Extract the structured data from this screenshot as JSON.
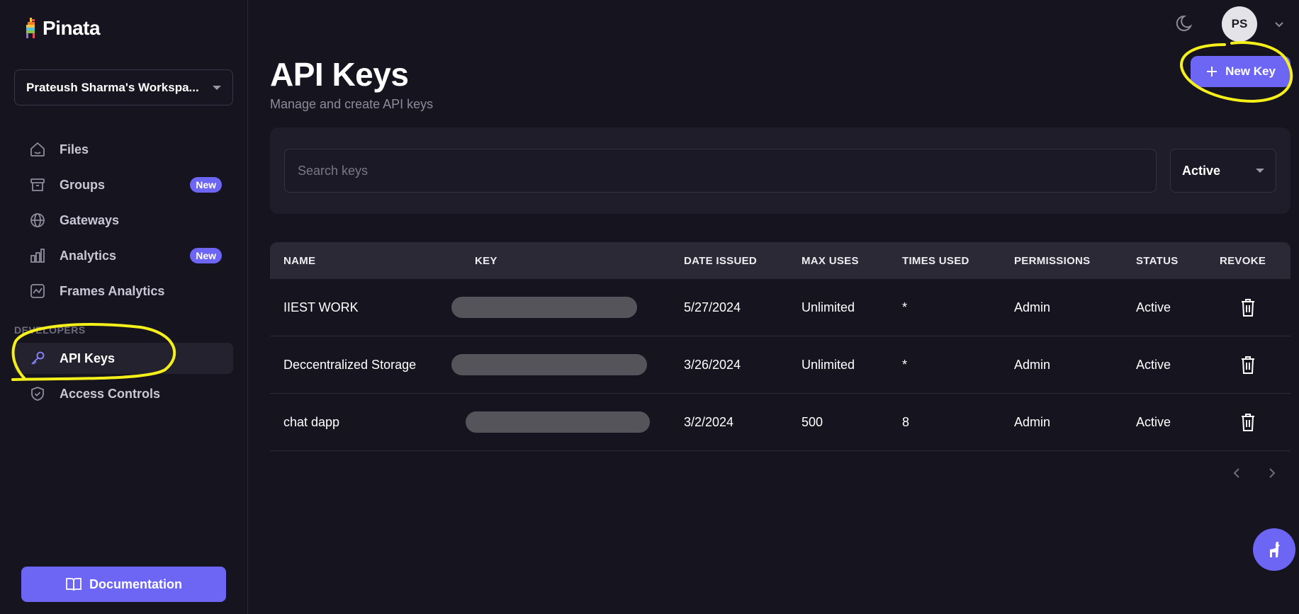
{
  "app": {
    "brand": "Pinata",
    "accent_color": "#6d66f5"
  },
  "sidebar": {
    "workspace": "Prateush Sharma's Workspa...",
    "items": [
      {
        "label": "Files",
        "icon": "home-icon"
      },
      {
        "label": "Groups",
        "icon": "archive-icon",
        "badge": "New"
      },
      {
        "label": "Gateways",
        "icon": "globe-icon"
      },
      {
        "label": "Analytics",
        "icon": "bar-chart-icon",
        "badge": "New"
      },
      {
        "label": "Frames Analytics",
        "icon": "line-chart-icon"
      }
    ],
    "section_label": "DEVELOPERS",
    "dev_items": [
      {
        "label": "API Keys",
        "icon": "key-icon",
        "active": true
      },
      {
        "label": "Access Controls",
        "icon": "shield-check-icon"
      }
    ],
    "documentation_label": "Documentation"
  },
  "header": {
    "avatar_initials": "PS",
    "theme_icon": "moon-icon"
  },
  "page": {
    "title": "API Keys",
    "subtitle": "Manage and create API keys",
    "new_key_label": "New Key"
  },
  "filters": {
    "search_placeholder": "Search keys",
    "status_value": "Active"
  },
  "table": {
    "columns": [
      "NAME",
      "KEY",
      "DATE ISSUED",
      "MAX USES",
      "TIMES USED",
      "PERMISSIONS",
      "STATUS",
      "REVOKE"
    ],
    "rows": [
      {
        "name": "IIEST WORK",
        "date": "5/27/2024",
        "max_uses": "Unlimited",
        "times_used": "*",
        "permissions": "Admin",
        "status": "Active"
      },
      {
        "name": "Deccentralized Storage",
        "date": "3/26/2024",
        "max_uses": "Unlimited",
        "times_used": "*",
        "permissions": "Admin",
        "status": "Active"
      },
      {
        "name": "chat dapp",
        "date": "3/2/2024",
        "max_uses": "500",
        "times_used": "8",
        "permissions": "Admin",
        "status": "Active"
      }
    ]
  },
  "annotation_color": "#f5ef1a"
}
